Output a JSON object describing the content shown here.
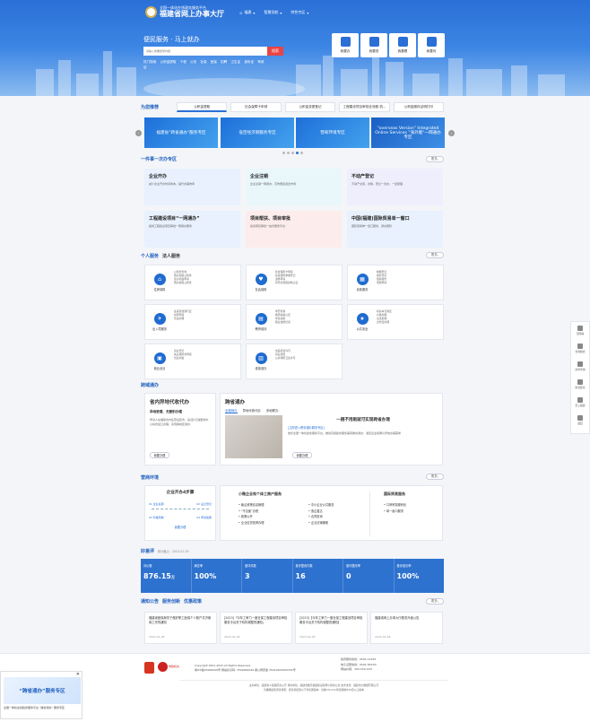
{
  "header": {
    "logo_line1": "全国一体化在线政务服务平台",
    "logo_line2": "福建省网上办事大厅",
    "nav": [
      "福建",
      "智慧导航",
      "特色专区"
    ],
    "slogan": "便民服务 · 马上就办",
    "search_placeholder": "请输入你要搜索内容",
    "search_button": "搜索",
    "hot_label": "热门搜索",
    "hot_words": [
      "公积金提取",
      "个税",
      "公安",
      "社保",
      "医保",
      "招聘",
      "卫生证",
      "身份证",
      "驾驶证"
    ],
    "quick": [
      "我要办",
      "我要查",
      "我要看",
      "我要问"
    ]
  },
  "recommend": {
    "title": "为您推荐",
    "tabs": [
      "公积金提取",
      "社会保障卡申领",
      "公积金变更登记",
      "工程建设项目审批全流程-机...",
      "公积金缴存证明打印"
    ],
    "banners": [
      "福建省“跨省通办”服务专区",
      "低空经济新服务专区",
      "营商环境专区",
      "\"overseas Version\" Integrated Online Services \"海外版\"一网通办专区"
    ]
  },
  "one_thing": {
    "title": "一件事一次办专区",
    "more": "更多",
    "cards": [
      {
        "h": "企业开办",
        "d": "减少企业开办时间成本，提升办事效率"
      },
      {
        "h": "企业注销",
        "d": "企业注销一网通办，高效便捷退出市场"
      },
      {
        "h": "不动产登记",
        "d": "不动产交易、办税、登记一次办，一窗受理"
      },
      {
        "h": "工程建设项目“一网通办”",
        "d": "提供工程建设项目审批一网通办服务"
      },
      {
        "h": "项目帮扶、项目审批",
        "d": "投资项目审批一站式服务平台"
      },
      {
        "h": "中国(福建)国际贸易单一窗口",
        "d": "国际贸易单一窗口服务，通关便利"
      }
    ]
  },
  "services": {
    "title_personal": "个人服务",
    "title_legal": "法人服务",
    "more": "更多",
    "items": [
      {
        "name": "住房保障",
        "desc": [
          "公积金查询",
          "租房提取公积金",
          "住房补贴申请",
          "购房提取公积金"
        ]
      },
      {
        "name": "社会保障",
        "desc": [
          "社会保障卡申领",
          "社会保险参保登记",
          "退休申请",
          "养老金领取资格认证"
        ]
      },
      {
        "name": "民政服务",
        "desc": [
          "婚姻登记",
          "收养登记",
          "殡葬服务",
          "低保申请"
        ]
      },
      {
        "name": "出入境服务",
        "desc": [
          "往来港澳通行证",
          "护照申领",
          "签注办理"
        ]
      },
      {
        "name": "教育培训",
        "desc": [
          "学历查询",
          "教师资格认定",
          "学生资助",
          "职业技能培训"
        ]
      },
      {
        "name": "公共安全",
        "desc": [
          "机动车驾驶证",
          "户籍办理",
          "违法处理",
          "身份证办理"
        ]
      },
      {
        "name": "就业创业",
        "desc": [
          "就业登记",
          "失业保险金申领",
          "创业补贴"
        ]
      },
      {
        "name": "准营准办",
        "desc": [
          "食品经营许可",
          "营业执照",
          "公共场所卫生许可"
        ]
      }
    ]
  },
  "cross": {
    "title": "跨域通办",
    "left_title": "省内异地代收代办",
    "left_sub": "异地受理、无差别办理",
    "left_desc": "申请人在福建省内任意设区市、县(区)行政服务中心综合窗口办理，实现跨地区通办",
    "left_btn": "我要办理",
    "right_title": "跨省通办",
    "right_tabs": [
      "全程网办",
      "异地代收代办",
      "多地联办"
    ],
    "right_head": "一趟不用跑就可实现跨省办理",
    "right_link": "[立即进入跨省通办服务专区]",
    "right_desc": "依托全国一体化政务服务平台，推动高频政务服务事项跨省通办，满足企业和群众异地办事需求",
    "right_btn": "我要办理"
  },
  "biz_env": {
    "title": "营商环境",
    "more": "更多",
    "flow_title": "企业开办4步骤",
    "flow_steps": [
      "01 企业名称",
      "02 设立登记",
      "03 印章刻制",
      "04 申领发票"
    ],
    "flow_btn": "我要办理",
    "mid_title": "小微企业和个体工商户服务",
    "mid_items": [
      "聚企政策信息管理",
      "“不见面”办税",
      "政策公开",
      "企业信贷抵押办理",
      "中小企业公共服务",
      "惠企直达",
      "合同查询",
      "企业法律援助"
    ],
    "right_title": "国际贸易服务",
    "right_items": [
      "口岸贸易便利化",
      "单一窗口服务"
    ]
  },
  "rating": {
    "title": "好差评",
    "date": "统计截止：2023-01-29",
    "stats": [
      {
        "l": "评价数",
        "v": "876.15",
        "u": "万"
      },
      {
        "l": "满意率",
        "v": "100%"
      },
      {
        "l": "差评件数",
        "v": "3"
      },
      {
        "l": "差评整改件数",
        "v": "16"
      },
      {
        "l": "差评整改率",
        "v": "0"
      },
      {
        "l": "差评回访率",
        "v": "100%"
      }
    ]
  },
  "notices": {
    "titles": [
      "通知公告",
      "服务创新",
      "优惠政策"
    ],
    "more": "更多",
    "items": [
      {
        "t": "福建省医保局关于做好职工医保个人账户共济使用工作的通知",
        "d": "2023-01-28"
      },
      {
        "t": "[2023]「今年工审力一度社保工程建设项目审批服务平台关于机构调整的通知」",
        "d": "2023-01-28"
      },
      {
        "t": "[2023]【今年工审力一度社保工程建设项目审批服务平台关于机构调整的通知】",
        "d": "2023-01-28"
      },
      {
        "t": "福建省网上办事大厅服务升级公告",
        "d": "2023-01-28"
      }
    ]
  },
  "footer": {
    "badge1": "党政机关",
    "copyright": "Copyright 2001-2023 All Rights Reserved.",
    "icp": "闽ICP备05006006号  网站标识码: 3500000049  闽公网安备 35010202000331号",
    "sponsor": "主办单位：福建省人民政府办公厅  承办单位：福建省数字福建建设领导小组办公室  技术支持：福建省大数据有限公司",
    "compat": "为确保最佳浏览效果，建议您使用以下浏览器版本：谷歌Chrome浏览器或IE10及以上版本",
    "hotline1": "政府服务热线：0591-12345",
    "hotline2": "电子证照热线：0591-8XXXX",
    "hotline3": "网站纠错：400-XXX-XXX"
  },
  "side": [
    "无障碍",
    "长者模式",
    "办件查询",
    "投诉建议",
    "掌上福建",
    "返回"
  ],
  "popup": {
    "title": "“跨省通办”服务专区",
    "cap": "全国一体化在线政务服务平台 “跨省通办” 服务专区"
  }
}
